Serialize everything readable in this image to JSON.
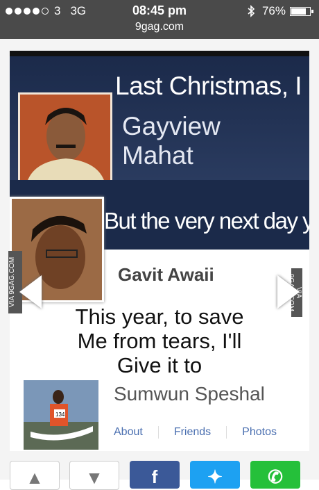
{
  "status_bar": {
    "carrier": "3",
    "network": "3G",
    "time": "08:45 pm",
    "url": "9gag.com",
    "battery": "76%",
    "battery_level": 0.76
  },
  "meme": {
    "panel1_line": "Last Christmas, I",
    "panel1_name_line1": "Gayview",
    "panel1_name_line2": "Mahat",
    "panel2_text": "But the very next day you",
    "panel2_name": "Gavit Awaii",
    "panel3_line1": "This year, to save",
    "panel3_line2": "Me from tears, I'll",
    "panel3_line3": "Give it to",
    "panel3_name": "Sumwun Speshal",
    "links": [
      "About",
      "Friends",
      "Photos"
    ],
    "watermark_left": "VIA 9GAG.COM",
    "watermark_right": "VIA 9GAG.COM",
    "runner_bib": "134"
  },
  "colors": {
    "status_bar": "#4a4a4a",
    "facebook": "#3b5998",
    "twitter": "#1da1f2",
    "whatsapp": "#25c03a",
    "link": "#4a6fb0"
  }
}
